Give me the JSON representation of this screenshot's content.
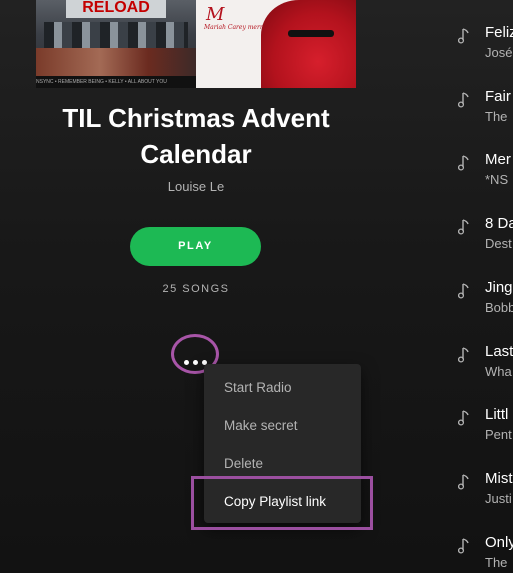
{
  "playlist": {
    "cover": {
      "left_banner": "RELOAD",
      "left_strip": "NSYNC • REMEMBER BEING • KELLY • ALL ABOUT YOU",
      "right_script": "M",
      "right_caption": "Mariah Carey merry christmas"
    },
    "title": "TIL Christmas Advent Calendar",
    "owner": "Louise Le",
    "play_label": "PLAY",
    "song_count": "25 SONGS"
  },
  "context_menu": {
    "items": [
      "Start Radio",
      "Make secret",
      "Delete",
      "Copy Playlist link"
    ]
  },
  "tracks": [
    {
      "title": "Feliz",
      "artist": "José"
    },
    {
      "title": "Fair",
      "artist": "The"
    },
    {
      "title": "Mer",
      "artist": "*NS"
    },
    {
      "title": "8 Da",
      "artist": "Dest"
    },
    {
      "title": "Jing",
      "artist": "Bobb"
    },
    {
      "title": "Last",
      "artist": "Wha"
    },
    {
      "title": "Littl",
      "artist": "Pent"
    },
    {
      "title": "Mist",
      "artist": "Justi"
    },
    {
      "title": "Only",
      "artist": "The"
    }
  ],
  "colors": {
    "accent": "#1db954",
    "annotation": "#9b4fa0",
    "menu_bg": "#282828"
  }
}
